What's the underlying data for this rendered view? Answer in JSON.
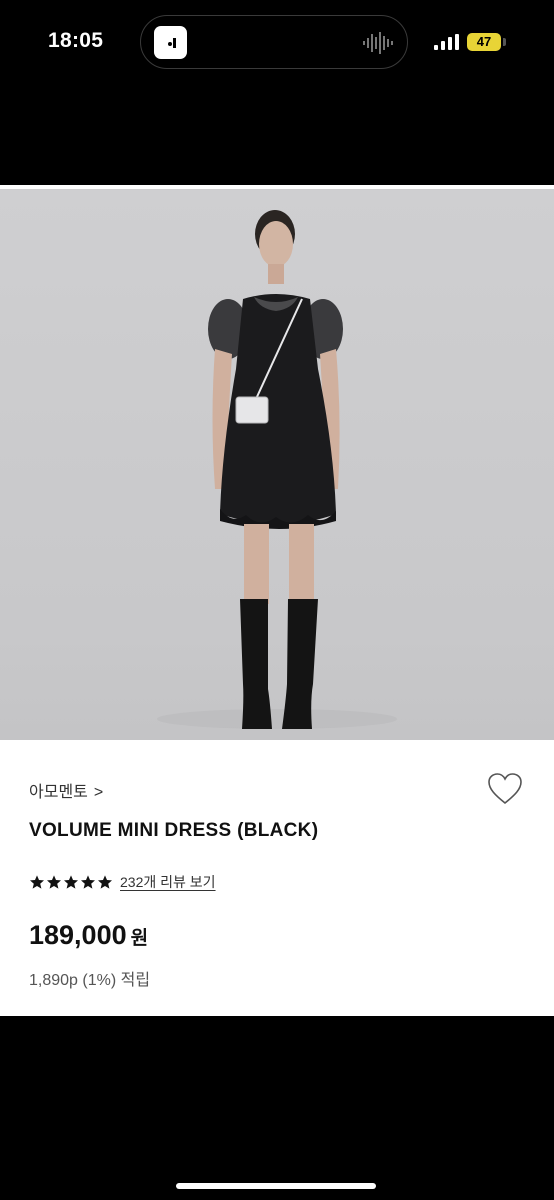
{
  "status_bar": {
    "time": "18:05",
    "battery_level": "47",
    "app_icon": "app-icon",
    "audio_icon": "audio-waveform-icon",
    "signal_icon": "cellular-signal-icon"
  },
  "product": {
    "brand": "아모멘토",
    "brand_chevron": ">",
    "title": "VOLUME MINI DRESS (BLACK)",
    "rating": 5,
    "review_link": "232개 리뷰 보기",
    "price": "189,000",
    "price_unit": "원",
    "points": "1,890p (1%) 적립"
  },
  "icons": {
    "heart": "heart-outline-icon",
    "star": "star-filled-icon"
  },
  "colors": {
    "battery": "#e8d436",
    "background": "#000000",
    "card": "#ffffff"
  }
}
